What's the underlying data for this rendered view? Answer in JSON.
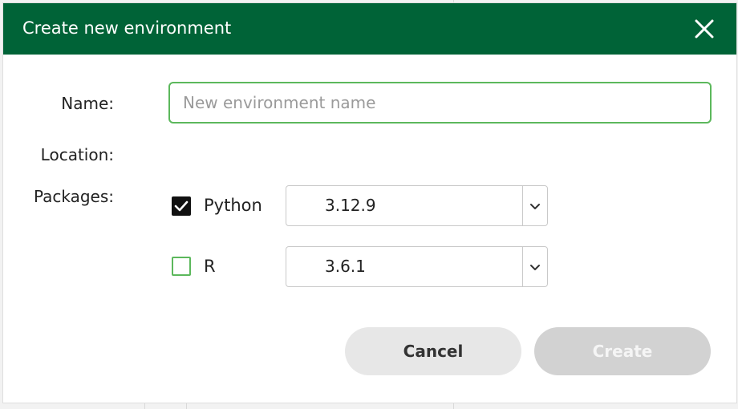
{
  "dialog": {
    "title": "Create new environment"
  },
  "form": {
    "name_label": "Name:",
    "name_placeholder": "New environment name",
    "name_value": "",
    "location_label": "Location:",
    "packages_label": "Packages:"
  },
  "packages": [
    {
      "name": "Python",
      "checked": true,
      "version": "3.12.9"
    },
    {
      "name": "R",
      "checked": false,
      "version": "3.6.1"
    }
  ],
  "buttons": {
    "cancel": "Cancel",
    "create": "Create",
    "create_enabled": false
  },
  "colors": {
    "header": "#006337",
    "focus_border": "#5cb85c",
    "cancel_bg": "#e7e7e7",
    "create_disabled_bg": "#d2d2d2"
  },
  "icons": {
    "close": "close-icon",
    "check": "checkmark-icon",
    "dropdown": "chevron-down-icon"
  }
}
